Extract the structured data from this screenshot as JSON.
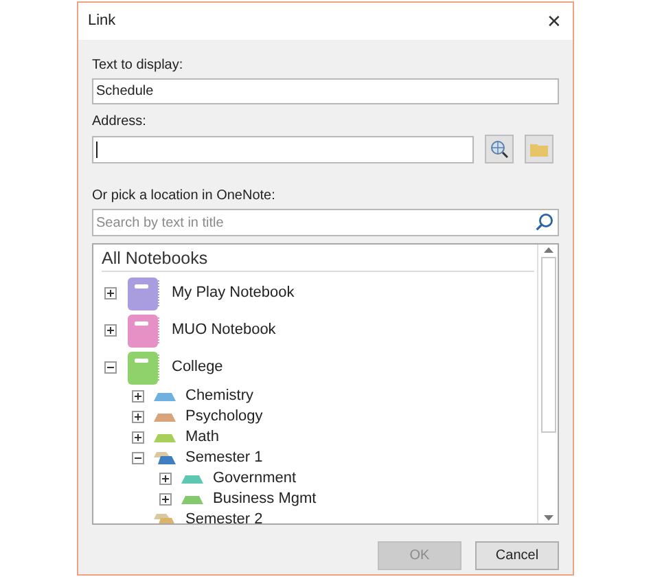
{
  "window": {
    "title": "Link",
    "close": "✕"
  },
  "text_to_display": {
    "label": "Text to display:",
    "value": "Schedule"
  },
  "address": {
    "label": "Address:"
  },
  "location": {
    "label": "Or pick a location in OneNote:",
    "search_placeholder": "Search by text in title"
  },
  "tree": {
    "header": "All Notebooks",
    "items": [
      {
        "kind": "notebook",
        "name": "My Play Notebook",
        "color": "#a99de0",
        "expanded": false
      },
      {
        "kind": "notebook",
        "name": "MUO Notebook",
        "color": "#e591c6",
        "expanded": false
      },
      {
        "kind": "notebook",
        "name": "College",
        "color": "#8fd16a",
        "expanded": true,
        "children": [
          {
            "kind": "section",
            "name": "Chemistry",
            "color": "#6fb0e0",
            "expanded": false
          },
          {
            "kind": "section",
            "name": "Psychology",
            "color": "#d7a47c",
            "expanded": false
          },
          {
            "kind": "section",
            "name": "Math",
            "color": "#a6d05a",
            "expanded": false
          },
          {
            "kind": "group",
            "name": "Semester 1",
            "color": "#3f7fc0",
            "expanded": true,
            "children": [
              {
                "kind": "section",
                "name": "Government",
                "color": "#5ec7b0",
                "expanded": false
              },
              {
                "kind": "section",
                "name": "Business Mgmt",
                "color": "#86c870",
                "expanded": false
              }
            ]
          },
          {
            "kind": "group",
            "name": "Semester 2",
            "color": "#d9b46a"
          }
        ]
      }
    ]
  },
  "buttons": [
    {
      "label": "OK",
      "disabled": true
    },
    {
      "label": "Cancel",
      "disabled": false
    }
  ]
}
